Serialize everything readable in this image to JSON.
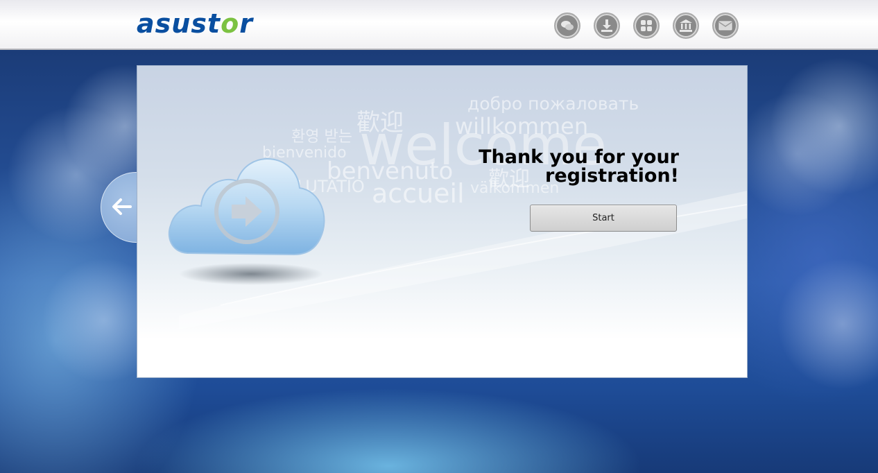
{
  "header": {
    "logo": {
      "pre": "asust",
      "o": "o",
      "post": "r"
    },
    "icons": [
      {
        "name": "chat-icon"
      },
      {
        "name": "download-icon"
      },
      {
        "name": "apps-icon"
      },
      {
        "name": "bank-icon"
      },
      {
        "name": "mail-icon"
      }
    ]
  },
  "welcome_words": [
    "добро пожаловать",
    "歡迎",
    "willkommen",
    "환영 받는",
    "welcome",
    "bienvenido",
    "benvenuto",
    "歡迎",
    "SALUTATIO",
    "accueil",
    "välkommen"
  ],
  "main": {
    "heading": "Thank you for your registration!",
    "start_label": "Start"
  },
  "colors": {
    "brand": "#0a4fa0",
    "brand_accent": "#7cc242",
    "background": "#1f3f7d"
  }
}
